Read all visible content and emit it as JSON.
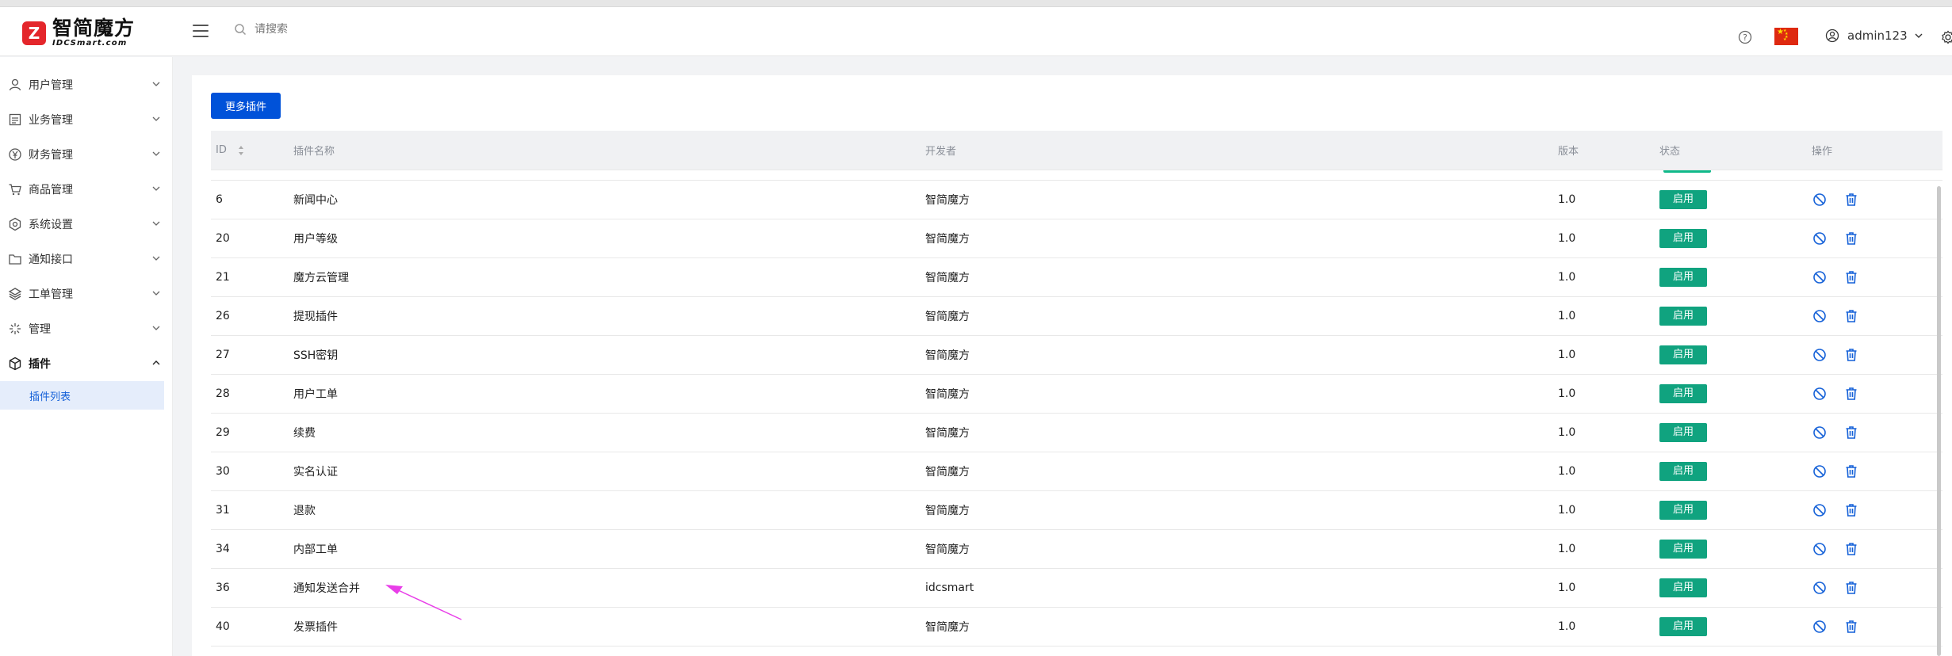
{
  "header": {
    "logo_cn": "智简魔方",
    "logo_en": "IDCSmart.com",
    "search_placeholder": "请搜索",
    "username": "admin123"
  },
  "sidebar": {
    "items": [
      {
        "label": "用户管理",
        "icon": "user-icon"
      },
      {
        "label": "业务管理",
        "icon": "list-icon"
      },
      {
        "label": "财务管理",
        "icon": "yen-icon"
      },
      {
        "label": "商品管理",
        "icon": "cart-icon"
      },
      {
        "label": "系统设置",
        "icon": "settings-icon"
      },
      {
        "label": "通知接口",
        "icon": "folder-icon"
      },
      {
        "label": "工单管理",
        "icon": "layers-icon"
      },
      {
        "label": "管理",
        "icon": "sparkle-icon"
      },
      {
        "label": "插件",
        "icon": "cube-icon"
      }
    ],
    "sub_item": "插件列表"
  },
  "main": {
    "more_button": "更多插件",
    "columns": {
      "id": "ID",
      "name": "插件名称",
      "developer": "开发者",
      "version": "版本",
      "status": "状态",
      "ops": "操作"
    },
    "rows": [
      {
        "id": "6",
        "name": "新闻中心",
        "developer": "智简魔方",
        "version": "1.0",
        "status": "启用"
      },
      {
        "id": "20",
        "name": "用户等级",
        "developer": "智简魔方",
        "version": "1.0",
        "status": "启用"
      },
      {
        "id": "21",
        "name": "魔方云管理",
        "developer": "智简魔方",
        "version": "1.0",
        "status": "启用"
      },
      {
        "id": "26",
        "name": "提现插件",
        "developer": "智简魔方",
        "version": "1.0",
        "status": "启用"
      },
      {
        "id": "27",
        "name": "SSH密钥",
        "developer": "智简魔方",
        "version": "1.0",
        "status": "启用"
      },
      {
        "id": "28",
        "name": "用户工单",
        "developer": "智简魔方",
        "version": "1.0",
        "status": "启用"
      },
      {
        "id": "29",
        "name": "续费",
        "developer": "智简魔方",
        "version": "1.0",
        "status": "启用"
      },
      {
        "id": "30",
        "name": "实名认证",
        "developer": "智简魔方",
        "version": "1.0",
        "status": "启用"
      },
      {
        "id": "31",
        "name": "退款",
        "developer": "智简魔方",
        "version": "1.0",
        "status": "启用"
      },
      {
        "id": "34",
        "name": "内部工单",
        "developer": "智简魔方",
        "version": "1.0",
        "status": "启用"
      },
      {
        "id": "36",
        "name": "通知发送合并",
        "developer": "idcsmart",
        "version": "1.0",
        "status": "启用"
      },
      {
        "id": "40",
        "name": "发票插件",
        "developer": "智简魔方",
        "version": "1.0",
        "status": "启用"
      }
    ]
  },
  "colors": {
    "primary": "#0052d9",
    "status_green": "#10a37f",
    "annotation_arrow": "#e83ee8"
  }
}
